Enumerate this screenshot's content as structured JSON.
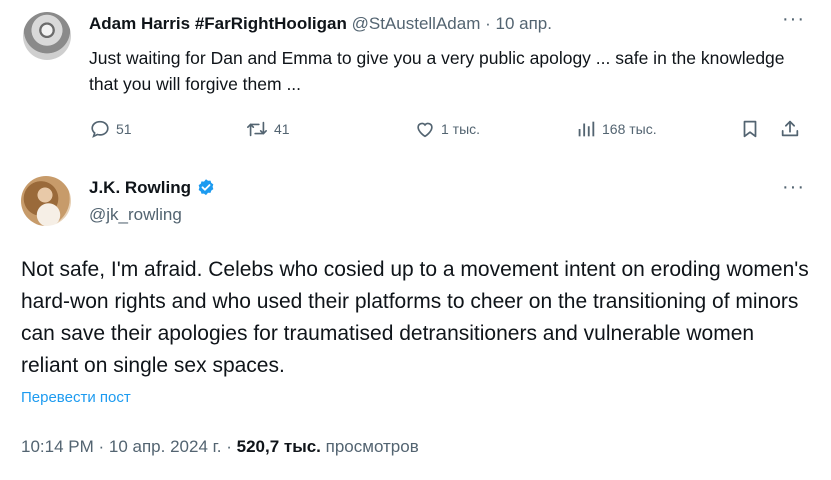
{
  "reply": {
    "author_name": "Adam Harris #FarRightHooligan",
    "author_handle": "@StAustellAdam",
    "separator": "·",
    "time": "10 апр.",
    "text": "Just waiting for Dan and Emma to give you a very public apology ... safe in the knowledge that you will forgive them ...",
    "more_label": "···",
    "actions": {
      "replies": "51",
      "reposts": "41",
      "likes": "1 тыс.",
      "views": "168 тыс."
    }
  },
  "tweet": {
    "author_name": "J.K. Rowling",
    "author_handle": "@jk_rowling",
    "more_label": "···",
    "text": "Not safe, I'm afraid. Celebs who cosied up to a movement intent on eroding women's hard-won rights and who used their platforms to cheer on the transitioning of minors can save their apologies for traumatised detransitioners and vulnerable women reliant on single sex spaces.",
    "translate_label": "Перевести пост",
    "time": "10:14 PM",
    "date": "10 апр. 2024 г.",
    "views_count": "520,7 тыс.",
    "views_label": "просмотров"
  },
  "colors": {
    "text": "#0f1419",
    "secondary": "#536471",
    "link": "#1d9bf0",
    "verified": "#1d9bf0"
  }
}
